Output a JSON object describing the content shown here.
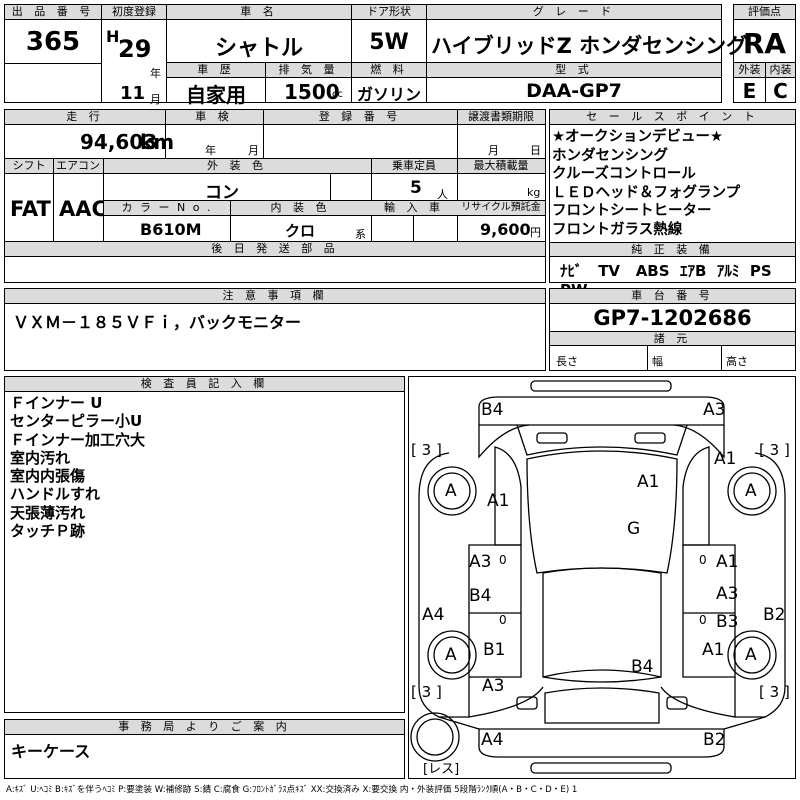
{
  "header": {
    "lot_label": "出 品 番 号",
    "lot": "365",
    "first_reg_label": "初度登録",
    "era": "H",
    "year": "29",
    "year_unit": "年",
    "month": "11",
    "month_unit": "月",
    "car_name_label": "車 名",
    "car_name": "シャトル",
    "door_label": "ドア形状",
    "door": "5W",
    "grade_label": "グ レ ー ド",
    "grade": "ハイブリッドZ ホンダセンシング",
    "score_label": "評価点",
    "score": "RA",
    "history_label": "車 歴",
    "history": "自家用",
    "displacement_label": "排 気 量",
    "displacement": "1500",
    "displacement_unit": "cc",
    "fuel_label": "燃 料",
    "fuel": "ガソリン",
    "model_label": "型 式",
    "model": "DAA-GP7",
    "ext_label": "外装",
    "ext_grade": "E",
    "int_label": "内装",
    "int_grade": "C"
  },
  "row2": {
    "mileage_label": "走 行",
    "mileage": "94,603",
    "mileage_unit": "km",
    "inspection_label": "車 検",
    "ins_year_unit": "年",
    "ins_month_unit": "月",
    "reg_no_label": "登 録 番 号",
    "transfer_label": "譲渡書類期限",
    "tr_month_unit": "月",
    "tr_day_unit": "日",
    "shift_label": "シフト",
    "shift": "FAT",
    "ac_label": "エアコン",
    "ac": "AAC",
    "color_label": "外 装 色",
    "color": "コン",
    "capacity_label": "乗車定員",
    "capacity": "5",
    "capacity_unit": "人",
    "load_label": "最大積載量",
    "load_unit": "kg",
    "colorno_label": "カ ラ ー N o .",
    "colorno": "B610M",
    "intcolor_label": "内 装 色",
    "intcolor": "クロ",
    "intcolor_unit": "系",
    "import_label": "輸 入 車",
    "recycle_label": "リサイクル預託金",
    "recycle": "9,600",
    "recycle_unit": "円",
    "later_label": "後 日 発 送 部 品"
  },
  "sales": {
    "label": "セ ー ル ス ポ イ ン ト",
    "lines": [
      "★オークションデビュー★",
      "ホンダセンシング",
      "クルーズコントロール",
      "ＬＥＤヘッド＆フォグランプ",
      "フロントシートヒーター",
      "フロントガラス熱線"
    ]
  },
  "equipment": {
    "label": "純 正 装 備",
    "items": [
      "ﾅﾋﾞ",
      "TV",
      "ABS",
      "ｴｱB",
      "ｱﾙﾐ",
      "PS",
      "PW"
    ]
  },
  "notes": {
    "label": "注 意 事 項 欄",
    "text": "ＶＸＭ－１８５ＶＦｉ，バックモニター"
  },
  "chassis": {
    "label": "車 台 番 号",
    "number": "GP7-1202686",
    "dims_label": "諸 元",
    "length_label": "長さ",
    "width_label": "幅",
    "height_label": "高さ"
  },
  "inspector": {
    "label": "検 査 員 記 入 欄",
    "lines": [
      "Ｆインナー U",
      "センターピラー小U",
      "Ｆインナー加工穴大",
      "室内汚れ",
      "室内内張傷",
      "ハンドルすれ",
      "天張薄汚れ",
      "タッチＰ跡"
    ]
  },
  "office": {
    "label": "事 務 局 よ り ご 案 内",
    "text": "キーケース"
  },
  "diagram": {
    "marks": {
      "b4_top": "B4",
      "a3_top": "A3",
      "a1_fr_fender": "A1",
      "a1_hood": "A1",
      "a1_fl_fender": "A1",
      "g_glass": "G",
      "a3_left_door": "A3",
      "a1_right_door": "A1",
      "b4_left_rdoor": "B4",
      "a3_right_rdoor": "A3",
      "b3_right": "B3",
      "a4_left": "A4",
      "b2_right": "B2",
      "b1_left": "B1",
      "a1_right_qtr": "A1",
      "b4_roof": "B4",
      "a3_left_rear": "A3",
      "a4_bottom": "A4",
      "b2_bottom": "B2"
    },
    "tyre_label": "A",
    "tread": "3",
    "spare": "レス",
    "zero": "0"
  },
  "legend": "A:ｷｽﾞ U:ﾍｺﾐ B:ｷｽﾞを伴うﾍｺﾐ P:要塗装 W:補修跡 S:錆 C:腐食 G:ﾌﾛﾝﾄｶﾞﾗｽ点ｷｽﾞ XX:交換済み X:要交換 内・外装評価 5段階ﾗﾝｸ順(A・B・C・D・E) 1"
}
